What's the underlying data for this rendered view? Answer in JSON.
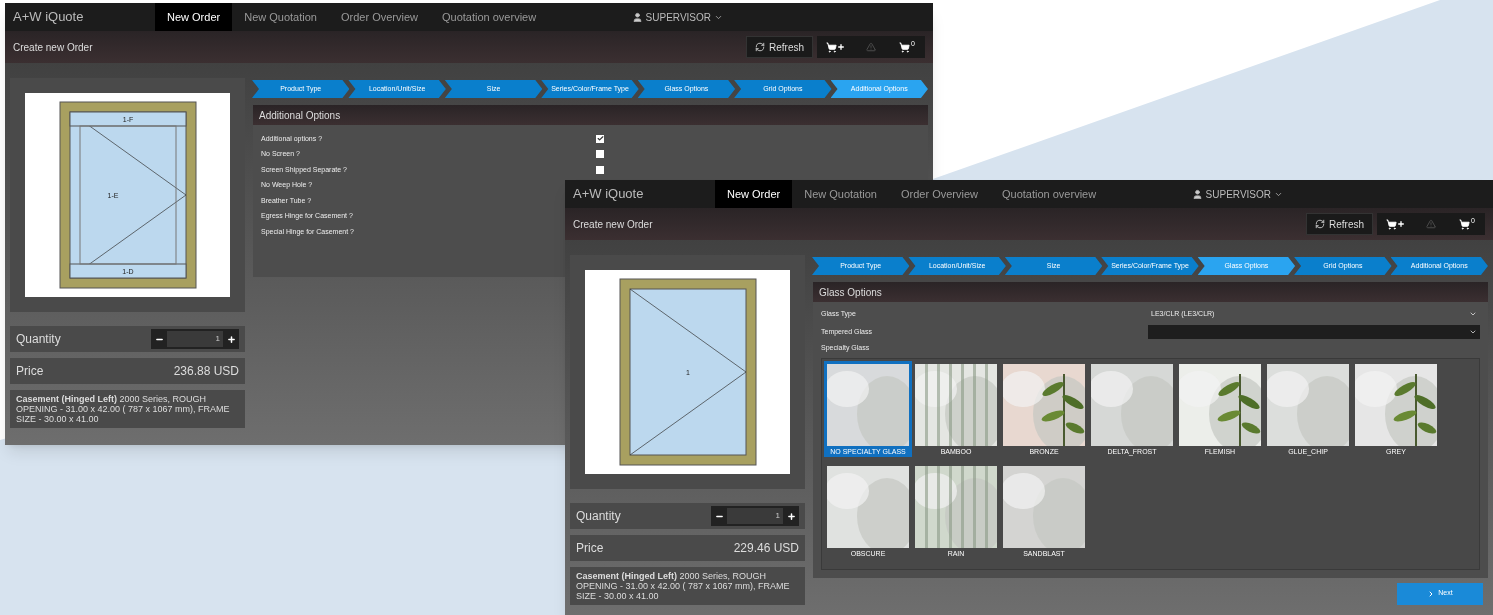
{
  "windows": [
    {
      "app_title": "A+W iQuote",
      "nav": [
        {
          "label": "New Order",
          "selected": true
        },
        {
          "label": "New Quotation",
          "selected": false
        },
        {
          "label": "Order Overview",
          "selected": false
        },
        {
          "label": "Quotation overview",
          "selected": false
        }
      ],
      "user": "SUPERVISOR",
      "page_title": "Create new Order",
      "refresh": "Refresh",
      "cart_count": "0",
      "steps": [
        {
          "label": "Product Type",
          "selected": false
        },
        {
          "label": "Location/Unit/Size",
          "selected": false
        },
        {
          "label": "Size",
          "selected": false
        },
        {
          "label": "Series/Color/Frame Type",
          "selected": false
        },
        {
          "label": "Glass Options",
          "selected": false
        },
        {
          "label": "Grid Options",
          "selected": false
        },
        {
          "label": "Additional Options",
          "selected": true
        }
      ],
      "drawing_labels": [
        "1-F",
        "1-E",
        "1-D"
      ],
      "quantity": {
        "label": "Quantity",
        "value": "1"
      },
      "price": {
        "label": "Price",
        "value": "236.88 USD"
      },
      "description": "**Casement (Hinged Left)** 2000 Series, ROUGH OPENING - 31.00 x 42.00 ( 787 x 1067 mm), FRAME SIZE - 30.00 x 41.00",
      "panel": {
        "kind": "options",
        "title": "Additional Options",
        "options": [
          {
            "label": "Additional options ?",
            "checked": true
          },
          {
            "label": "No Screen ?",
            "checked": false
          },
          {
            "label": "Screen Shipped Separate ?",
            "checked": false
          },
          {
            "label": "No Weep Hole ?"
          },
          {
            "label": "Breather Tube ?"
          },
          {
            "label": "Egress Hinge for Casement ?"
          },
          {
            "label": "Special Hinge for Casement ?"
          }
        ]
      }
    },
    {
      "app_title": "A+W iQuote",
      "nav": [
        {
          "label": "New Order",
          "selected": true
        },
        {
          "label": "New Quotation",
          "selected": false
        },
        {
          "label": "Order Overview",
          "selected": false
        },
        {
          "label": "Quotation overview",
          "selected": false
        }
      ],
      "user": "SUPERVISOR",
      "page_title": "Create new Order",
      "refresh": "Refresh",
      "cart_count": "0",
      "steps": [
        {
          "label": "Product Type",
          "selected": false
        },
        {
          "label": "Location/Unit/Size",
          "selected": false
        },
        {
          "label": "Size",
          "selected": false
        },
        {
          "label": "Series/Color/Frame Type",
          "selected": false
        },
        {
          "label": "Glass Options",
          "selected": true
        },
        {
          "label": "Grid Options",
          "selected": false
        },
        {
          "label": "Additional Options",
          "selected": false
        }
      ],
      "drawing_labels": [
        "1"
      ],
      "quantity": {
        "label": "Quantity",
        "value": "1"
      },
      "price": {
        "label": "Price",
        "value": "229.46 USD"
      },
      "description": "**Casement (Hinged Left)** 2000 Series, ROUGH OPENING - 31.00 x 42.00 ( 787 x 1067 mm), FRAME SIZE - 30.00 x 41.00",
      "panel": {
        "kind": "glass",
        "title": "Glass Options",
        "fields": [
          {
            "label": "Glass Type",
            "value": "LE3/CLR (LE3/CLR)"
          },
          {
            "label": "Tempered Glass"
          }
        ],
        "specialty_label": "Specialty Glass",
        "tiles": [
          {
            "label": "NO SPECIALTY GLASS",
            "selected": true
          },
          {
            "label": "BAMBOO",
            "selected": false
          },
          {
            "label": "BRONZE",
            "selected": false
          },
          {
            "label": "DELTA_FROST",
            "selected": false
          },
          {
            "label": "FLEMISH",
            "selected": false
          },
          {
            "label": "GLUE_CHIP",
            "selected": false
          },
          {
            "label": "GREY",
            "selected": false
          },
          {
            "label": "OBSCURE",
            "selected": false
          },
          {
            "label": "RAIN",
            "selected": false
          },
          {
            "label": "SANDBLAST",
            "selected": false
          }
        ],
        "next": "Next"
      }
    }
  ]
}
